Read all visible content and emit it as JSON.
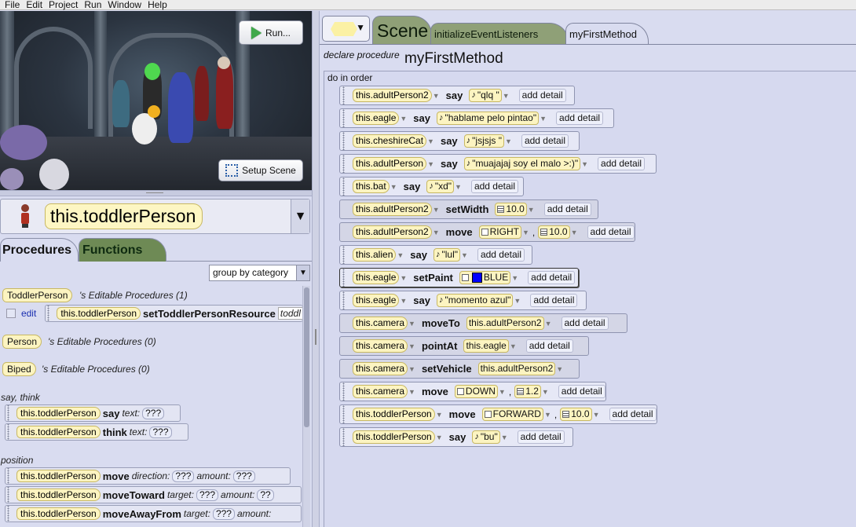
{
  "menu": [
    "File",
    "Edit",
    "Project",
    "Run",
    "Window",
    "Help"
  ],
  "scene_view": {
    "run_label": "Run...",
    "setup_label": "Setup Scene"
  },
  "selector": {
    "value": "this.toddlerPerson"
  },
  "left_tabs": {
    "procedures": "Procedures",
    "functions": "Functions"
  },
  "group_select": "group by category",
  "editable": [
    {
      "type": "ToddlerPerson",
      "suffix": "'s Editable Procedures (1)"
    },
    {
      "type": "Person",
      "suffix": "'s Editable Procedures (0)"
    },
    {
      "type": "Biped",
      "suffix": "'s Editable Procedures (0)"
    }
  ],
  "edit_row": {
    "edit_label": "edit",
    "target": "this.toddlerPerson",
    "method": "setToddlerPersonResource",
    "param": "toddl"
  },
  "categories": {
    "say_think": "say, think",
    "position": "position"
  },
  "say_think_rows": [
    {
      "target": "this.toddlerPerson",
      "method": "say",
      "param": "text:",
      "value": "???"
    },
    {
      "target": "this.toddlerPerson",
      "method": "think",
      "param": "text:",
      "value": "???"
    }
  ],
  "position_rows": [
    {
      "target": "this.toddlerPerson",
      "method": "move",
      "p1": "direction:",
      "v1": "???",
      "p2": "amount:",
      "v2": "???"
    },
    {
      "target": "this.toddlerPerson",
      "method": "moveToward",
      "p1": "target:",
      "v1": "???",
      "p2": "amount:",
      "v2": "??"
    },
    {
      "target": "this.toddlerPerson",
      "method": "moveAwayFrom",
      "p1": "target:",
      "v1": "???",
      "p2": "amount:",
      "v2": ""
    }
  ],
  "editor_tabs": {
    "scene": "Scene",
    "init": "initializeEventListeners",
    "current": "myFirstMethod"
  },
  "procedure": {
    "declare": "declare procedure",
    "name": "myFirstMethod",
    "do_in_order": "do in order"
  },
  "add_detail": "add detail",
  "color_blue": "#0000ff",
  "statements": [
    {
      "target": "this.adultPerson2",
      "method": "say",
      "args": [
        "\"qlq \""
      ]
    },
    {
      "target": "this.eagle",
      "method": "say",
      "args": [
        "\"hablame pelo pintao\""
      ]
    },
    {
      "target": "this.cheshireCat",
      "method": "say",
      "args": [
        "\"jsjsjs \""
      ]
    },
    {
      "target": "this.adultPerson",
      "method": "say",
      "args": [
        "\"muajajaj soy el malo >:)\""
      ]
    },
    {
      "target": "this.bat",
      "method": "say",
      "args": [
        "\"xd\""
      ]
    },
    {
      "target": "this.adultPerson2",
      "method": "setWidth",
      "args": [
        "10.0"
      ]
    },
    {
      "target": "this.adultPerson2",
      "method": "move",
      "args": [
        "RIGHT",
        "10.0"
      ]
    },
    {
      "target": "this.alien",
      "method": "say",
      "args": [
        "\"lul\""
      ]
    },
    {
      "target": "this.eagle",
      "method": "setPaint",
      "args": [
        "BLUE"
      ]
    },
    {
      "target": "this.eagle",
      "method": "say",
      "args": [
        "\"momento azul\""
      ]
    },
    {
      "target": "this.camera",
      "method": "moveTo",
      "args": [
        "this.adultPerson2"
      ]
    },
    {
      "target": "this.camera",
      "method": "pointAt",
      "args": [
        "this.eagle"
      ]
    },
    {
      "target": "this.camera",
      "method": "setVehicle",
      "args": [
        "this.adultPerson2"
      ]
    },
    {
      "target": "this.camera",
      "method": "move",
      "args": [
        "DOWN",
        "1.2"
      ]
    },
    {
      "target": "this.toddlerPerson",
      "method": "move",
      "args": [
        "FORWARD",
        "10.0"
      ]
    },
    {
      "target": "this.toddlerPerson",
      "method": "say",
      "args": [
        "\"bu\""
      ]
    }
  ]
}
